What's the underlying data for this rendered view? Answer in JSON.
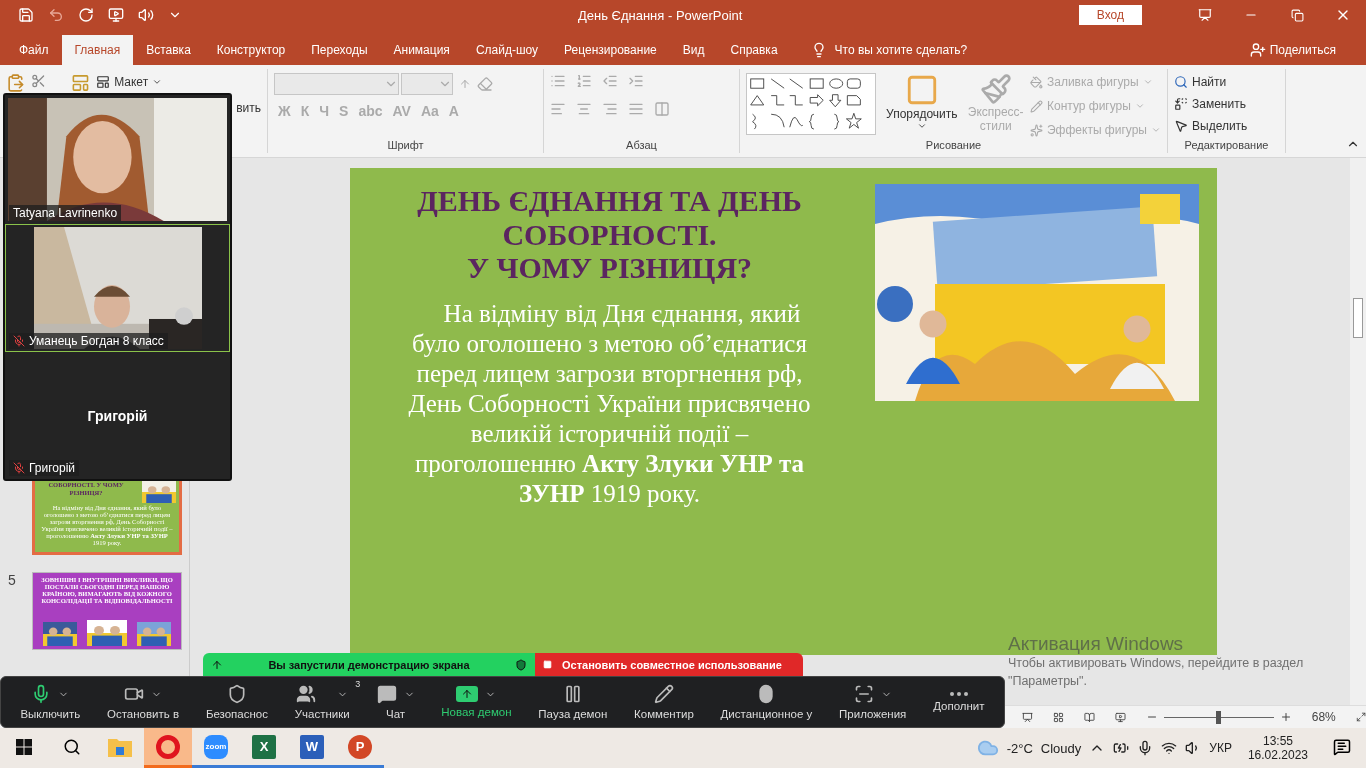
{
  "window": {
    "title": "День Єднання  -  PowerPoint",
    "sign_in": "Вход"
  },
  "ribbon_tabs": [
    {
      "label": "Файл",
      "selected": false
    },
    {
      "label": "Главная",
      "selected": true
    },
    {
      "label": "Вставка",
      "selected": false
    },
    {
      "label": "Конструктор",
      "selected": false
    },
    {
      "label": "Переходы",
      "selected": false
    },
    {
      "label": "Анимация",
      "selected": false
    },
    {
      "label": "Слайд-шоу",
      "selected": false
    },
    {
      "label": "Рецензирование",
      "selected": false
    },
    {
      "label": "Вид",
      "selected": false
    },
    {
      "label": "Справка",
      "selected": false
    }
  ],
  "tell_me": "Что вы хотите сделать?",
  "share": "Поделиться",
  "ribbon": {
    "layout": "Макет",
    "restore_partial": "вить",
    "font_buttons": [
      "Ж",
      "К",
      "Ч",
      "S",
      "abc",
      "AV",
      "Aa",
      "A"
    ],
    "font_label": "Шрифт",
    "paragraph_label": "Абзац",
    "drawing_label": "Рисование",
    "editing_label": "Редактирование",
    "arrange": "Упорядочить",
    "quick_styles": "Экспресс-стили",
    "shape_format": [
      {
        "label": "Заливка фигуры",
        "disabled": true
      },
      {
        "label": "Контур фигуры",
        "disabled": true
      },
      {
        "label": "Эффекты фигуры",
        "disabled": true
      }
    ],
    "editing": [
      "Найти",
      "Заменить",
      "Выделить"
    ]
  },
  "thumbnails": [
    {
      "selected": true,
      "kind": "current",
      "title": "СОБОРНОСТІ. У ЧОМУ РІЗНИЦЯ?",
      "body": "На відміну від Дня єднання, який було оголошено з метою об’єднатися перед лицем загрози вторгнення рф, День Соборності України присвячено великій історичній події – проголошенню **Акту Злуки УНР та ЗУНР** 1919 року."
    },
    {
      "number": "5",
      "selected": false,
      "kind": "purple",
      "title": "ЗОВНІШНІ І ВНУТРІШНІ ВИКЛИКИ, ЩО ПОСТАЛИ СЬОГОДНІ ПЕРЕД НАШОЮ КРАЇНОЮ, ВИМАГАЮТЬ ВІД КОЖНОГО КОНСОЛІДАЦІЇ ТА ВІДПОВІДАЛЬНОСТІ"
    }
  ],
  "slide": {
    "title": [
      "ДЕНЬ ЄДНАННЯ ТА ДЕНЬ СОБОРНОСТІ.",
      "У ЧОМУ РІЗНИЦЯ?"
    ],
    "body": "На відміну від Дня єднання, який було оголошено з метою об’єднатися перед лицем загрози вторгнення рф, День Соборності України присвячено великій історичній події – проголошенню **Акту Злуки УНР та ЗУНР** 1919 року."
  },
  "status_bar": {
    "zoom": "68%",
    "zoom_level": {
      "level": 0.5
    }
  },
  "video_gallery": [
    {
      "name": "Tatyana Lavrinenko",
      "muted": false,
      "active": false,
      "video": true
    },
    {
      "name": "Уманець Богдан 8 класс",
      "muted": true,
      "active": true,
      "video": true
    },
    {
      "name": "Григорій",
      "muted": true,
      "active": false,
      "video": false,
      "center_name": "Григорій"
    }
  ],
  "share_bar": {
    "status": "Вы запустили демонстрацию экрана",
    "stop": "Остановить совместное использование"
  },
  "meeting_toolbar": [
    {
      "label": "Выключить",
      "caret": true,
      "active": false
    },
    {
      "label": "Остановить в",
      "caret": true,
      "active": false
    },
    {
      "label": "Безопаснос",
      "caret": false,
      "active": false
    },
    {
      "label": "Участники",
      "caret": true,
      "active": false,
      "badge": "3"
    },
    {
      "label": "Чат",
      "caret": true,
      "active": false
    },
    {
      "label": "Новая демон",
      "caret": true,
      "active": true
    },
    {
      "label": "Пауза демон",
      "caret": false,
      "active": false
    },
    {
      "label": "Комментир",
      "caret": false,
      "active": false
    },
    {
      "label": "Дистанционное у",
      "caret": false,
      "active": false
    },
    {
      "label": "Приложения",
      "caret": true,
      "active": false
    },
    {
      "label": "Дополнит",
      "caret": false,
      "active": false
    }
  ],
  "activation": {
    "title": "Активация Windows",
    "text": "Чтобы активировать Windows, перейдите в раздел \"Параметры\"."
  },
  "taskbar": {
    "apps": [
      {
        "kind": "explorer",
        "selected": false,
        "running": false
      },
      {
        "kind": "opera",
        "selected": true,
        "running": true
      },
      {
        "kind": "zoom",
        "glyph": "zoom",
        "selected": false,
        "running": true
      },
      {
        "kind": "excel",
        "glyph": "X",
        "selected": false,
        "running": true
      },
      {
        "kind": "word",
        "glyph": "W",
        "selected": false,
        "running": true
      },
      {
        "kind": "powerpoint",
        "glyph": "P",
        "selected": false,
        "running": true
      }
    ],
    "temperature": "-2°C",
    "weather": "Cloudy",
    "language": "УКР",
    "time": "13:55",
    "date": "16.02.2023"
  }
}
